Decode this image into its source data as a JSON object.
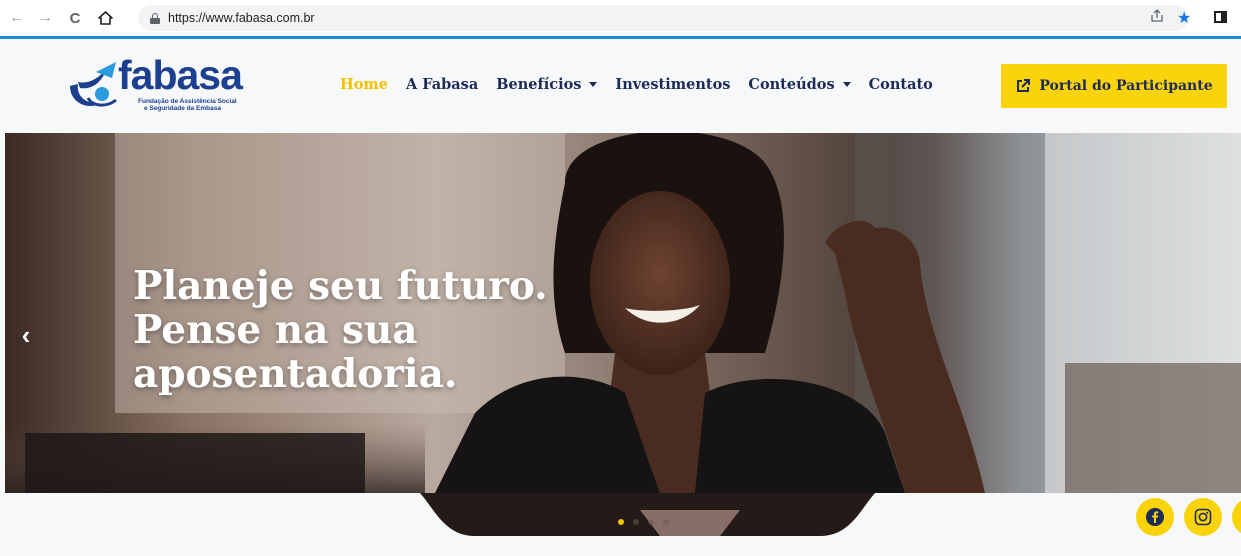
{
  "browser": {
    "url": "https://www.fabasa.com.br",
    "icons": [
      "back-arrow-icon",
      "forward-arrow-icon",
      "reload-icon",
      "home-icon",
      "lock-icon",
      "share-icon",
      "star-icon",
      "side-panel-icon"
    ]
  },
  "header": {
    "logo_text": "fabasa",
    "logo_tagline_line1": "Fundação de Assistência Social",
    "logo_tagline_line2": "e Seguridade da Embasa",
    "nav": [
      {
        "label": "Home",
        "active": true
      },
      {
        "label": "A Fabasa"
      },
      {
        "label": "Benefícios",
        "dropdown": true
      },
      {
        "label": "Investimentos"
      },
      {
        "label": "Conteúdos",
        "dropdown": true
      },
      {
        "label": "Contato"
      }
    ],
    "portal_button": "Portal do Participante"
  },
  "hero": {
    "line1": "Planeje seu futuro.",
    "line2": "Pense na sua",
    "line3": "aposentadoria.",
    "prev_arrow": "‹",
    "slides_count": 4,
    "active_slide": 1
  },
  "social": [
    "facebook-icon",
    "instagram-icon"
  ],
  "colors": {
    "brand_blue": "#1c3f8f",
    "brand_yellow": "#fbd30a",
    "nav_text": "#1c2b57",
    "active_nav": "#f2c200",
    "page_bg": "#f6f8fa"
  }
}
